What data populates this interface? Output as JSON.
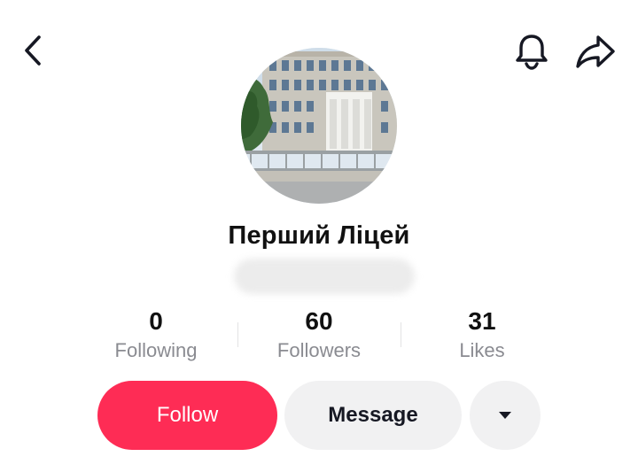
{
  "header": {
    "back_icon": "chevron-left-icon",
    "notification_icon": "bell-icon",
    "share_icon": "share-arrow-icon"
  },
  "profile": {
    "avatar": "school-building-photo",
    "display_name": "Перший Ліцей"
  },
  "stats": [
    {
      "value": "0",
      "label": "Following"
    },
    {
      "value": "60",
      "label": "Followers"
    },
    {
      "value": "31",
      "label": "Likes"
    }
  ],
  "actions": {
    "follow_label": "Follow",
    "message_label": "Message",
    "more_icon": "caret-down-icon"
  },
  "colors": {
    "accent": "#fe2c55",
    "secondary_button_bg": "#f1f1f2",
    "muted_text": "#8a8b91"
  }
}
